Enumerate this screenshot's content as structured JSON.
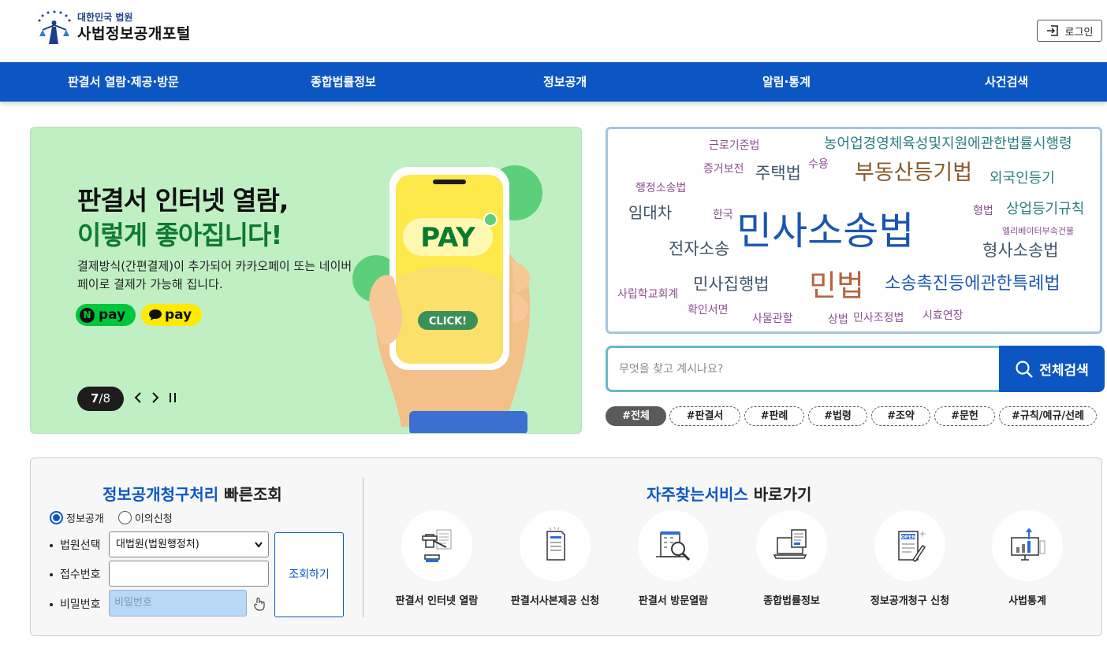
{
  "header": {
    "logo_sub": "대한민국 법원",
    "logo_main": "사법정보공개포털",
    "login_label": "로그인"
  },
  "nav": {
    "items": [
      "판결서 열람·제공·방문",
      "종합법률정보",
      "정보공개",
      "알림·통계",
      "사건검색"
    ]
  },
  "banner": {
    "title_line1": "판결서 인터넷 열람,",
    "title_line2": "이렇게 좋아집니다!",
    "description": "결제방식(간편결제)이 추가되어 카카오페이 또는 네이버페이로 결제가 가능해 집니다.",
    "npay_n": "N",
    "npay_text": "pay",
    "kpay_text": "pay",
    "phone_pay": "PAY",
    "phone_click": "CLICK!",
    "slide_current": "7",
    "slide_total": "/8",
    "prev_icon": "chevron-left-icon",
    "next_icon": "chevron-right-icon",
    "pause_icon": "pause-icon"
  },
  "word_cloud": {
    "words": [
      "근로기준법",
      "농어업경영체육성및지원에관한법률시행령",
      "증거보전",
      "수용",
      "주택법",
      "부동산등기법",
      "외국인등기",
      "행정소송법",
      "임대차",
      "한국",
      "민사소송법",
      "형법",
      "상업등기규칙",
      "엘리베이터부속건물",
      "전자소송",
      "형사소송법",
      "민사집행법",
      "민법",
      "소송촉진등에관한특례법",
      "사립학교회계",
      "확인서면",
      "사물관할",
      "상법",
      "민사조정법",
      "시효연장"
    ],
    "colors": {
      "blue": "#1a56b0",
      "teal": "#2a7f7a",
      "slate": "#3f5468",
      "brown": "#8b5a2b",
      "purple": "#8a4f8e",
      "rust": "#b5653f"
    }
  },
  "search": {
    "placeholder": "무엇을 찾고 계시나요?",
    "button_label": "전체검색",
    "tags": [
      "#전체",
      "#판결서",
      "#판례",
      "#법령",
      "#조약",
      "#문헌",
      "#규칙/예규/선례"
    ],
    "active_tag": "#전체"
  },
  "quick_lookup": {
    "title_blue": "정보공개청구처리",
    "title_black": " 빠른조회",
    "radio_options": [
      "정보공개",
      "이의신청"
    ],
    "radio_selected": "정보공개",
    "court_label": "법원선택",
    "court_value": "대법원(법원행정처)",
    "receipt_label": "접수번호",
    "receipt_value": "",
    "password_label": "비밀번호",
    "password_placeholder": "비밀번호",
    "lookup_button": "조회하기"
  },
  "services": {
    "title_blue": "자주찾는서비스",
    "title_black": " 바로가기",
    "items": [
      {
        "label": "판결서 인터넷 열람",
        "icon": "gavel-icon"
      },
      {
        "label": "판결서사본제공 신청",
        "icon": "document-icon"
      },
      {
        "label": "판결서 방문열람",
        "icon": "building-search-icon"
      },
      {
        "label": "종합법률정보",
        "icon": "laptop-document-icon"
      },
      {
        "label": "정보공개청구 신청",
        "icon": "open-document-icon"
      },
      {
        "label": "사법통계",
        "icon": "statistics-monitor-icon"
      }
    ]
  },
  "colors": {
    "primary": "#0c56c4",
    "banner_bg": "#c1efc4",
    "banner_green_text": "#0d7a32",
    "panel_bg": "#f7f7f7"
  }
}
